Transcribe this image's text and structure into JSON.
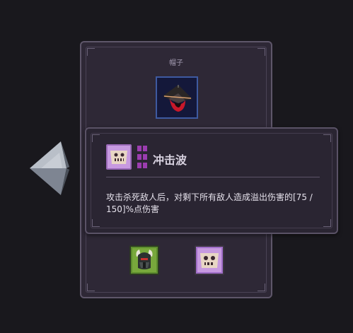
{
  "panel": {
    "title": "帽子",
    "equipped_item_icon": "hat-icon",
    "bottom_slots": [
      {
        "icon": "horned-helmet-icon",
        "color": "#6fa23a"
      },
      {
        "icon": "scroll-icon",
        "color": "#b07ad6"
      }
    ]
  },
  "navigation": {
    "prev_icon": "arrow-left-icon"
  },
  "tooltip": {
    "skill_icon": "scroll-icon",
    "skill_name": "冲击波",
    "description": "攻击杀死敌人后，对剩下所有敌人造成溢出伤害的[75 / 150]%点伤害",
    "tier_color": "#9b3db0"
  },
  "colors": {
    "background": "#19181d",
    "panel": "#2e2836",
    "tooltip": "#2a2532",
    "slot_blue": "#3e5aa0"
  }
}
